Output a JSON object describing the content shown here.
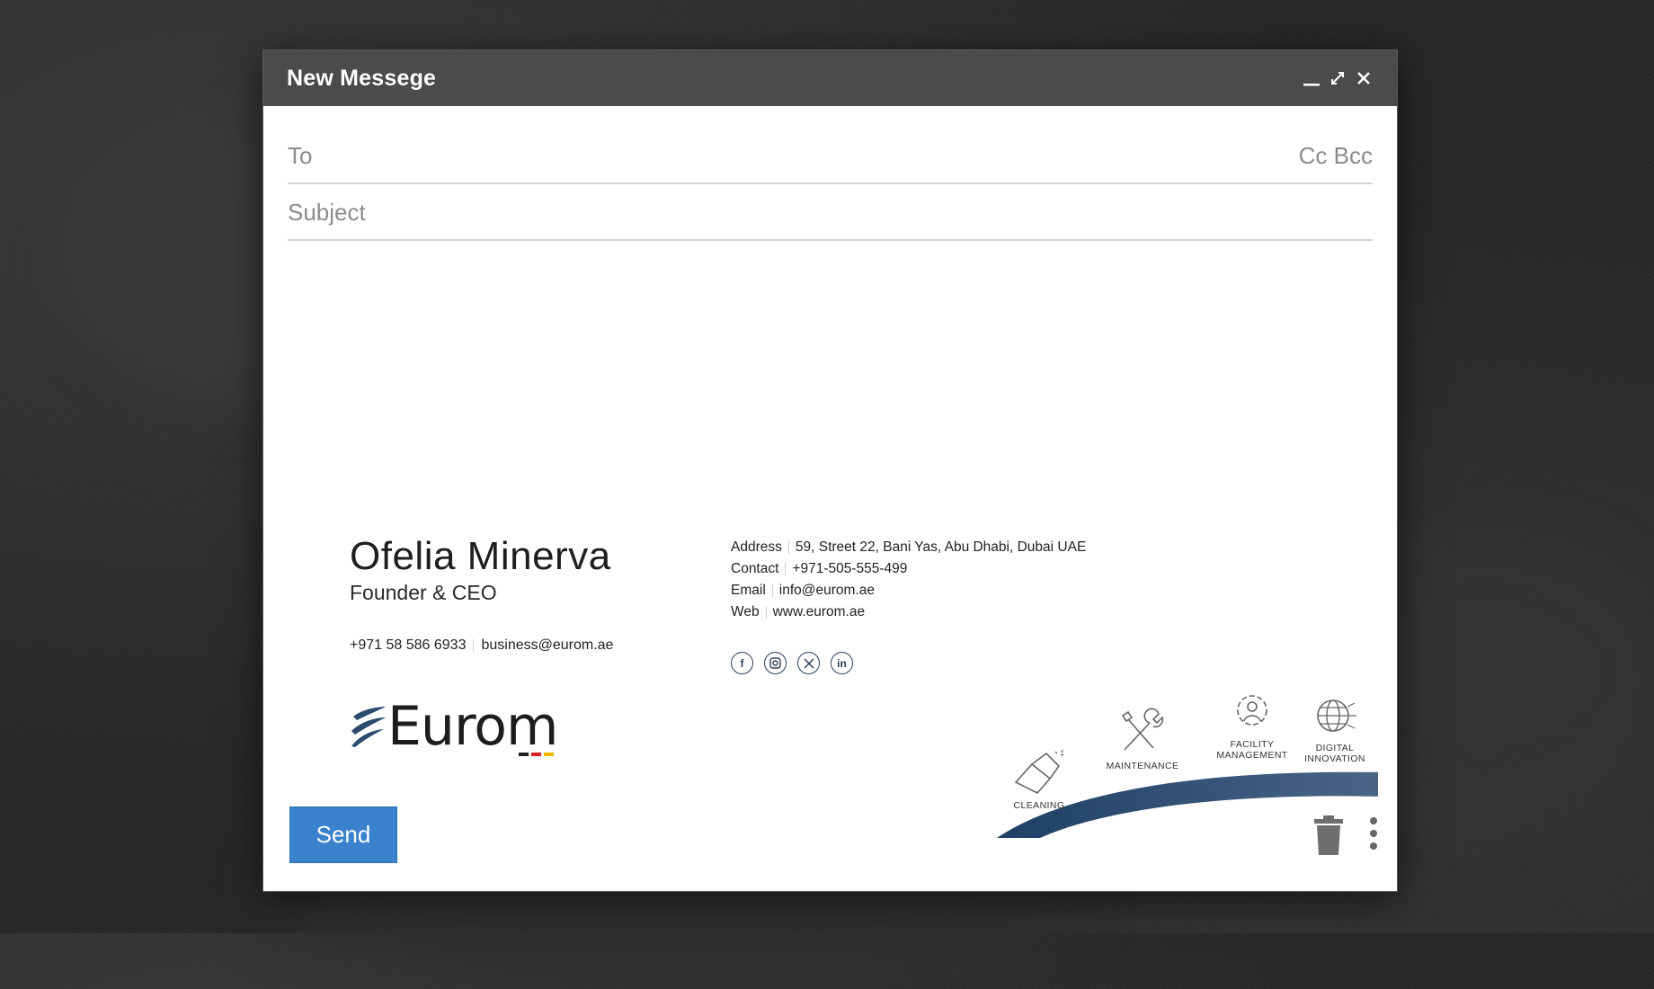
{
  "window": {
    "title": "New Messege"
  },
  "compose": {
    "to_placeholder": "To",
    "cc_label": "Cc",
    "bcc_label": "Bcc",
    "subject_placeholder": "Subject",
    "send_label": "Send"
  },
  "signature": {
    "name": "Ofelia Minerva",
    "role": "Founder & CEO",
    "phone": "+971 58 586 6933",
    "email": "business@eurom.ae",
    "logo_text": "Eurom",
    "contact": [
      {
        "label": "Address",
        "value": "59, Street 22, Bani Yas, Abu Dhabi, Dubai UAE"
      },
      {
        "label": "Contact",
        "value": "+971-505-555-499"
      },
      {
        "label": "Email",
        "value": "info@eurom.ae"
      },
      {
        "label": "Web",
        "value": "www.eurom.ae"
      }
    ],
    "social": [
      "facebook-icon",
      "instagram-icon",
      "x-twitter-icon",
      "linkedin-icon"
    ],
    "services": [
      {
        "label1": "CLEANING",
        "label2": ""
      },
      {
        "label1": "MAINTENANCE",
        "label2": ""
      },
      {
        "label1": "FACILITY",
        "label2": "MANAGEMENT"
      },
      {
        "label1": "DIGITAL",
        "label2": "INNOVATION"
      }
    ]
  },
  "colors": {
    "titlebar": "#4b4b4b",
    "send": "#3b82cc",
    "brand_navy": "#274566"
  }
}
